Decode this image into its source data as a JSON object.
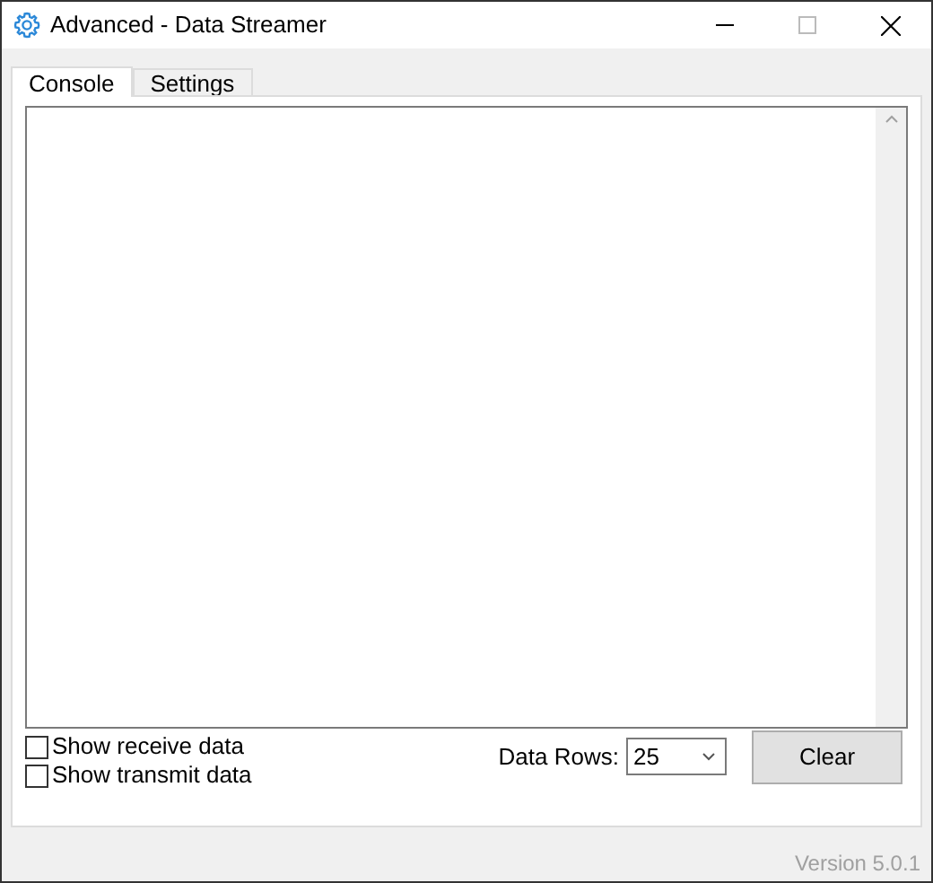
{
  "window": {
    "title": "Advanced - Data Streamer"
  },
  "tabs": [
    {
      "label": "Console",
      "selected": true
    },
    {
      "label": "Settings",
      "selected": false
    }
  ],
  "console": {
    "checkboxes": [
      {
        "label": "Show receive data",
        "checked": false
      },
      {
        "label": "Show transmit data",
        "checked": false
      }
    ],
    "data_rows": {
      "label": "Data Rows:",
      "value": "25"
    },
    "clear_button": "Clear"
  },
  "status_bar": {
    "version": "Version 5.0.1"
  }
}
